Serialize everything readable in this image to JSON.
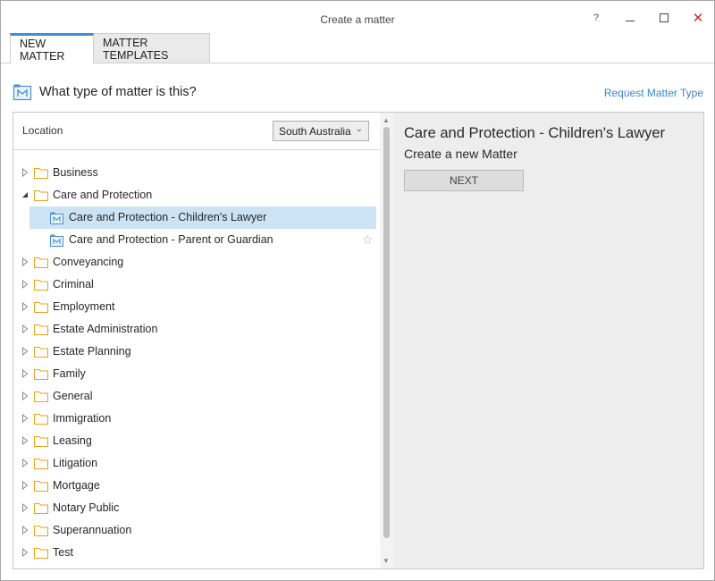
{
  "window": {
    "title": "Create a matter",
    "help_label": "?",
    "close_label": "✕"
  },
  "tabs": [
    {
      "label": "NEW MATTER",
      "active": true
    },
    {
      "label": "MATTER TEMPLATES",
      "active": false
    }
  ],
  "heading": {
    "text": "What type of matter is this?",
    "request_link": "Request Matter Type"
  },
  "location": {
    "label": "Location",
    "selected": "South Australia"
  },
  "tree": [
    {
      "label": "Business",
      "expanded": false
    },
    {
      "label": "Care and Protection",
      "expanded": true,
      "children": [
        {
          "label": "Care and Protection - Children's Lawyer",
          "selected": true
        },
        {
          "label": "Care and Protection - Parent or Guardian",
          "selected": false
        }
      ]
    },
    {
      "label": "Conveyancing",
      "expanded": false
    },
    {
      "label": "Criminal",
      "expanded": false
    },
    {
      "label": "Employment",
      "expanded": false
    },
    {
      "label": "Estate Administration",
      "expanded": false
    },
    {
      "label": "Estate Planning",
      "expanded": false
    },
    {
      "label": "Family",
      "expanded": false
    },
    {
      "label": "General",
      "expanded": false
    },
    {
      "label": "Immigration",
      "expanded": false
    },
    {
      "label": "Leasing",
      "expanded": false
    },
    {
      "label": "Litigation",
      "expanded": false
    },
    {
      "label": "Mortgage",
      "expanded": false
    },
    {
      "label": "Notary Public",
      "expanded": false
    },
    {
      "label": "Superannuation",
      "expanded": false
    },
    {
      "label": "Test",
      "expanded": false
    }
  ],
  "detail": {
    "title": "Care and Protection - Children's Lawyer",
    "subtitle": "Create a new Matter",
    "next_label": "NEXT"
  },
  "colors": {
    "accent": "#3a8fd6",
    "selection": "#cce3f6",
    "folder": "#e8a317",
    "link": "#3a86c9",
    "close": "#c4282d"
  },
  "icons": {
    "folder": "folder-icon",
    "matter_type": "matter-type-icon",
    "favorite": "star-icon"
  }
}
